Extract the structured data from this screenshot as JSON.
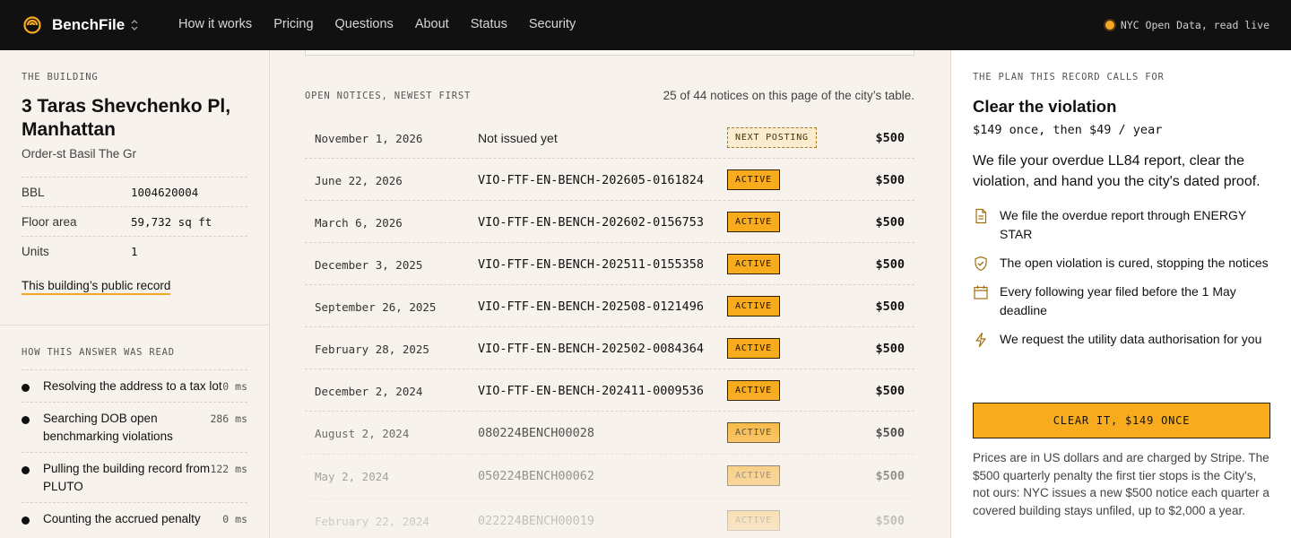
{
  "app": {
    "brand": "BenchFile",
    "nav": [
      "How it works",
      "Pricing",
      "Questions",
      "About",
      "Status",
      "Security"
    ],
    "live_status": "NYC Open Data, read live",
    "accent": "#f9ab1e"
  },
  "building": {
    "eyebrow": "THE BUILDING",
    "name": "3 Taras Shevchenko Pl, Manhattan",
    "owner": "Order-st Basil The Gr",
    "facts": [
      {
        "label": "BBL",
        "value": "1004620004"
      },
      {
        "label": "Floor area",
        "value": "59,732 sq ft"
      },
      {
        "label": "Units",
        "value": "1"
      }
    ],
    "record_link": "This building’s public record"
  },
  "read_steps": {
    "eyebrow": "HOW THIS ANSWER WAS READ",
    "items": [
      {
        "label": "Resolving the address to a tax lot",
        "ms": "0 ms"
      },
      {
        "label": "Searching DOB open benchmarking violations",
        "ms": "286 ms"
      },
      {
        "label": "Pulling the building record from PLUTO",
        "ms": "122 ms"
      },
      {
        "label": "Counting the accrued penalty",
        "ms": "0 ms"
      }
    ]
  },
  "notices": {
    "eyebrow": "OPEN NOTICES, NEWEST FIRST",
    "count": "25 of 44 notices on this page of the city’s table.",
    "rows": [
      {
        "date": "November 1, 2026",
        "id": "Not issued yet",
        "status": "NEXT POSTING",
        "amount": "$500"
      },
      {
        "date": "June 22, 2026",
        "id": "VIO-FTF-EN-BENCH-202605-0161824",
        "status": "ACTIVE",
        "amount": "$500"
      },
      {
        "date": "March 6, 2026",
        "id": "VIO-FTF-EN-BENCH-202602-0156753",
        "status": "ACTIVE",
        "amount": "$500"
      },
      {
        "date": "December 3, 2025",
        "id": "VIO-FTF-EN-BENCH-202511-0155358",
        "status": "ACTIVE",
        "amount": "$500"
      },
      {
        "date": "September 26, 2025",
        "id": "VIO-FTF-EN-BENCH-202508-0121496",
        "status": "ACTIVE",
        "amount": "$500"
      },
      {
        "date": "February 28, 2025",
        "id": "VIO-FTF-EN-BENCH-202502-0084364",
        "status": "ACTIVE",
        "amount": "$500"
      },
      {
        "date": "December 2, 2024",
        "id": "VIO-FTF-EN-BENCH-202411-0009536",
        "status": "ACTIVE",
        "amount": "$500"
      },
      {
        "date": "August 2, 2024",
        "id": "080224BENCH00028",
        "status": "ACTIVE",
        "amount": "$500"
      },
      {
        "date": "May 2, 2024",
        "id": "050224BENCH00062",
        "status": "ACTIVE",
        "amount": "$500"
      },
      {
        "date": "February 22, 2024",
        "id": "022224BENCH00019",
        "status": "ACTIVE",
        "amount": "$500"
      }
    ]
  },
  "plan": {
    "eyebrow": "THE PLAN THIS RECORD CALLS FOR",
    "title": "Clear the violation",
    "price": "$149 once, then $49 / year",
    "lede": "We file your overdue LL84 report, clear the violation, and hand you the city's dated proof.",
    "features": [
      {
        "icon": "document-icon",
        "text": "We file the overdue report through ENERGY STAR"
      },
      {
        "icon": "shield-check-icon",
        "text": "The open violation is cured, stopping the notices"
      },
      {
        "icon": "calendar-icon",
        "text": "Every following year filed before the 1 May deadline"
      },
      {
        "icon": "lightning-icon",
        "text": "We request the utility data authorisation for you"
      }
    ],
    "cta": "CLEAR IT, $149 ONCE",
    "fineprint": "Prices are in US dollars and are charged by Stripe. The $500 quarterly penalty the first tier stops is the City's, not ours: NYC issues a new $500 notice each quarter a covered building stays unfiled, up to $2,000 a year."
  }
}
